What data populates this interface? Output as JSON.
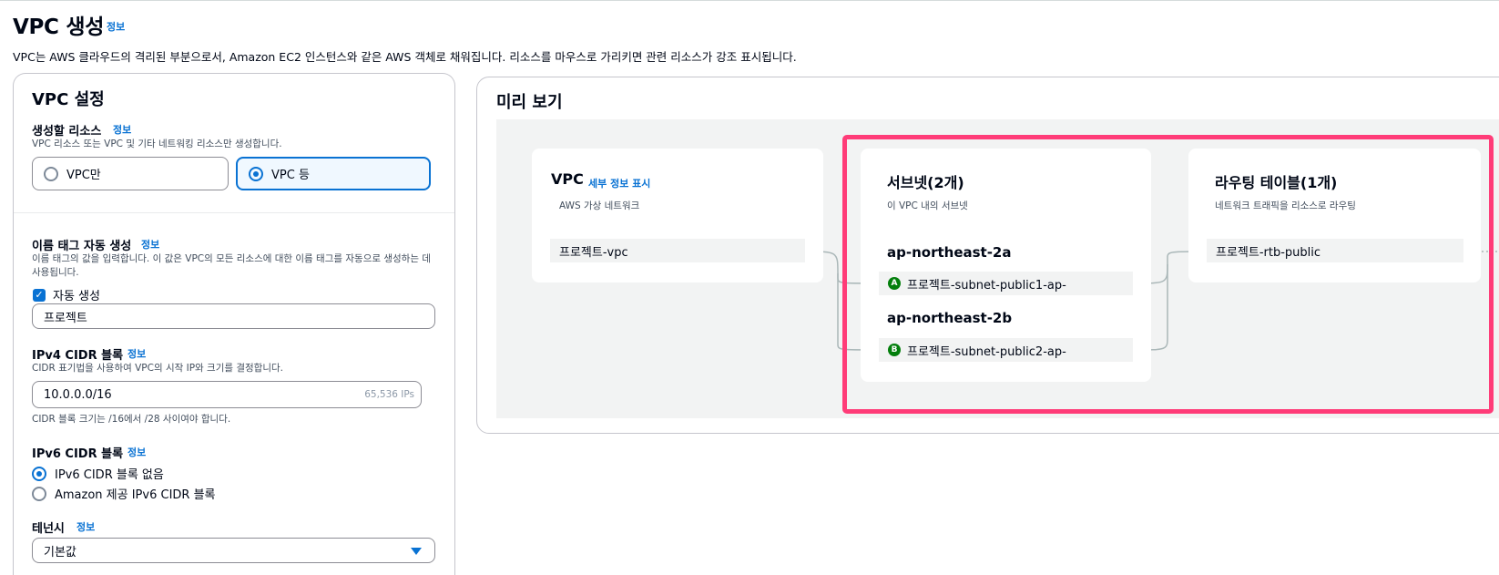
{
  "page": {
    "title": "VPC 생성",
    "title_info": "정보",
    "description": "VPC는 AWS 클라우드의 격리된 부분으로서, Amazon EC2 인스턴스와 같은 AWS 객체로 채워집니다. 리소스를 마우스로 가리키면 관련 리소스가 강조 표시됩니다."
  },
  "settings": {
    "title": "VPC 설정",
    "resources": {
      "label": "생성할 리소스",
      "info": "정보",
      "description": "VPC 리소스 또는 VPC 및 기타 네트워킹 리소스만 생성합니다.",
      "options": [
        "VPC만",
        "VPC 등"
      ],
      "selected": "VPC 등"
    },
    "name_tag": {
      "label": "이름 태그 자동 생성",
      "info": "정보",
      "description": "이름 태그의 값을 입력합니다. 이 값은 VPC의 모든 리소스에 대한 이름 태그를 자동으로 생성하는 데 사용됩니다.",
      "checkbox_label": "자동 생성",
      "checked": true,
      "value": "프로젝트"
    },
    "ipv4": {
      "label": "IPv4 CIDR 블록",
      "info": "정보",
      "description": "CIDR 표기법을 사용하여 VPC의 시작 IP와 크기를 결정합니다.",
      "value": "10.0.0.0/16",
      "hint": "65,536 IPs",
      "constraint": "CIDR 블록 크기는 /16에서 /28 사이여야 합니다."
    },
    "ipv6": {
      "label": "IPv6 CIDR 블록",
      "info": "정보",
      "options": [
        "IPv6 CIDR 블록 없음",
        "Amazon 제공 IPv6 CIDR 블록"
      ],
      "selected": "IPv6 CIDR 블록 없음"
    },
    "tenancy": {
      "label": "테넌시",
      "info": "정보",
      "value": "기본값"
    }
  },
  "preview": {
    "title": "미리 보기",
    "vpc": {
      "title": "VPC",
      "link": "세부 정보 표시",
      "subtitle": "AWS 가상 네트워크",
      "resource": "프로젝트-vpc"
    },
    "subnets": {
      "title": "서브넷(2개)",
      "subtitle": "이 VPC 내의 서브넷",
      "zones": [
        {
          "name": "ap-northeast-2a",
          "badge": "A",
          "subnet": "프로젝트-subnet-public1-ap-"
        },
        {
          "name": "ap-northeast-2b",
          "badge": "B",
          "subnet": "프로젝트-subnet-public2-ap-"
        }
      ]
    },
    "route_tables": {
      "title": "라우팅 테이블(1개)",
      "subtitle": "네트워크 트래픽을 리소스로 라우팅",
      "resource": "프로젝트-rtb-public"
    }
  },
  "colors": {
    "accent": "#0972d3",
    "highlight": "#ff3c78",
    "badge": "#037f0c"
  }
}
